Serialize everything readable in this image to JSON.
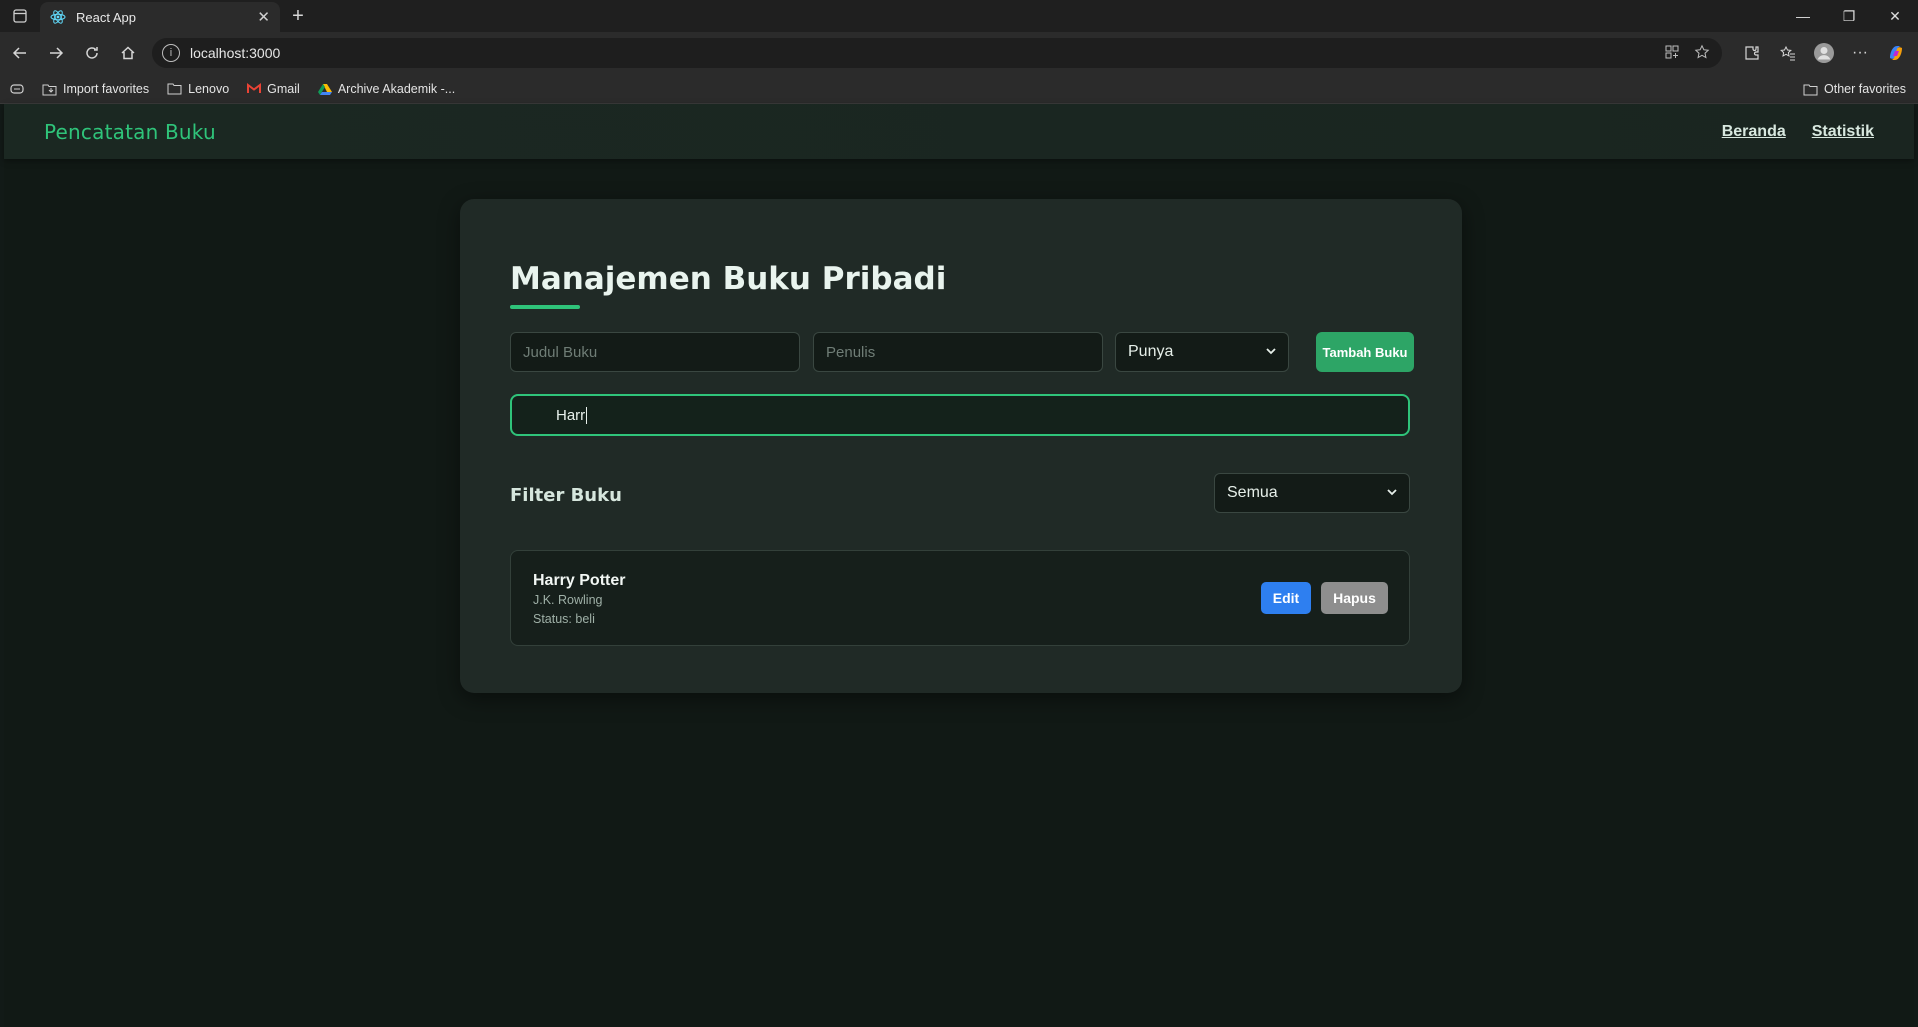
{
  "browser": {
    "tab_title": "React App",
    "url": "localhost:3000",
    "favorites": [
      {
        "label": "Import favorites",
        "icon": "import-icon"
      },
      {
        "label": "Lenovo",
        "icon": "folder-icon"
      },
      {
        "label": "Gmail",
        "icon": "gmail-icon"
      },
      {
        "label": "Archive Akademik -...",
        "icon": "drive-icon"
      }
    ],
    "other_favorites": "Other favorites"
  },
  "app": {
    "brand": "Pencatatan Buku",
    "nav": {
      "home": "Beranda",
      "stats": "Statistik"
    },
    "heading": "Manajemen Buku Pribadi",
    "form": {
      "title_placeholder": "Judul Buku",
      "author_placeholder": "Penulis",
      "status_selected": "Punya",
      "add_button": "Tambah Buku"
    },
    "search": {
      "value": "Harr"
    },
    "filter": {
      "title": "Filter Buku",
      "selected": "Semua"
    },
    "books": [
      {
        "title": "Harry Potter",
        "author": "J.K. Rowling",
        "status": "Status: beli"
      }
    ],
    "book_actions": {
      "edit": "Edit",
      "delete": "Hapus"
    }
  },
  "colors": {
    "accent": "#2fc47a",
    "add_button": "#2da566",
    "edit_button": "#2e7ff0",
    "delete_button": "#8e8e8e",
    "background": "#111915",
    "card": "#202a26"
  }
}
